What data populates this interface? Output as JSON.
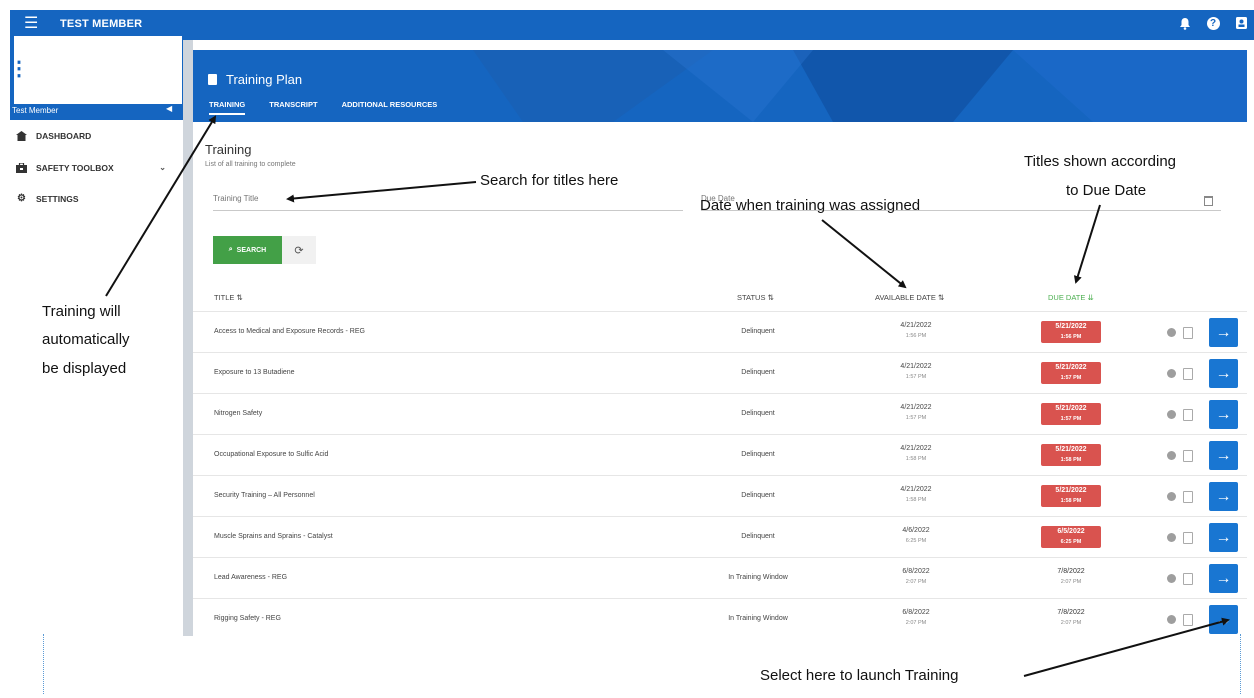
{
  "topbar": {
    "member_name": "TEST MEMBER",
    "icons": [
      "menu-icon",
      "bell-icon",
      "help-icon",
      "user-icon"
    ]
  },
  "sidebar": {
    "member_label": "Test Member",
    "items": [
      {
        "label": "DASHBOARD",
        "icon": "dashboard-icon"
      },
      {
        "label": "SAFETY TOOLBOX",
        "icon": "toolbox-icon",
        "has_chevron": true
      },
      {
        "label": "SETTINGS",
        "icon": "gear-icon"
      }
    ]
  },
  "header": {
    "title": "Training Plan",
    "tabs": [
      {
        "label": "TRAINING",
        "active": true
      },
      {
        "label": "TRANSCRIPT",
        "active": false
      },
      {
        "label": "ADDITIONAL RESOURCES",
        "active": false
      }
    ]
  },
  "main": {
    "title": "Training",
    "subtitle": "List of all training to complete",
    "search_placeholder": "Training Title",
    "due_placeholder": "Due Date",
    "search_button": "SEARCH"
  },
  "table": {
    "columns": {
      "title": "TITLE",
      "status": "STATUS",
      "available": "AVAILABLE DATE",
      "due": "DUE DATE"
    },
    "rows": [
      {
        "title": "Access to Medical and Exposure Records - REG",
        "status": "Delinquent",
        "avail_date": "4/21/2022",
        "avail_time": "1:56 PM",
        "due_date": "5/21/2022",
        "due_time": "1:56 PM",
        "overdue": true
      },
      {
        "title": "Exposure to 13 Butadiene",
        "status": "Delinquent",
        "avail_date": "4/21/2022",
        "avail_time": "1:57 PM",
        "due_date": "5/21/2022",
        "due_time": "1:57 PM",
        "overdue": true
      },
      {
        "title": "Nitrogen Safety",
        "status": "Delinquent",
        "avail_date": "4/21/2022",
        "avail_time": "1:57 PM",
        "due_date": "5/21/2022",
        "due_time": "1:57 PM",
        "overdue": true
      },
      {
        "title": "Occupational Exposure to Sulfic Acid",
        "status": "Delinquent",
        "avail_date": "4/21/2022",
        "avail_time": "1:58 PM",
        "due_date": "5/21/2022",
        "due_time": "1:58 PM",
        "overdue": true
      },
      {
        "title": "Security Training – All Personnel",
        "status": "Delinquent",
        "avail_date": "4/21/2022",
        "avail_time": "1:58 PM",
        "due_date": "5/21/2022",
        "due_time": "1:58 PM",
        "overdue": true
      },
      {
        "title": "Muscle Sprains and Sprains - Catalyst",
        "status": "Delinquent",
        "avail_date": "4/6/2022",
        "avail_time": "6:25 PM",
        "due_date": "6/5/2022",
        "due_time": "6:25 PM",
        "overdue": true
      },
      {
        "title": "Lead Awareness - REG",
        "status": "In Training Window",
        "avail_date": "6/8/2022",
        "avail_time": "2:07 PM",
        "due_date": "7/8/2022",
        "due_time": "2:07 PM",
        "overdue": false
      },
      {
        "title": "Rigging Safety - REG",
        "status": "In Training Window",
        "avail_date": "6/8/2022",
        "avail_time": "2:07 PM",
        "due_date": "7/8/2022",
        "due_time": "2:07 PM",
        "overdue": false
      }
    ]
  },
  "annotations": {
    "search": "Search for titles here",
    "assigned": "Date when training was assigned",
    "due_line1": "Titles shown according",
    "due_line2": "to Due Date",
    "auto_line1": "Training will",
    "auto_line2": "automatically",
    "auto_line3": "be displayed",
    "launch": "Select here to launch Training"
  },
  "colors": {
    "brand_blue": "#1565c0",
    "overdue_red": "#d9534f",
    "search_green": "#43a047",
    "launch_blue": "#1976d2"
  }
}
